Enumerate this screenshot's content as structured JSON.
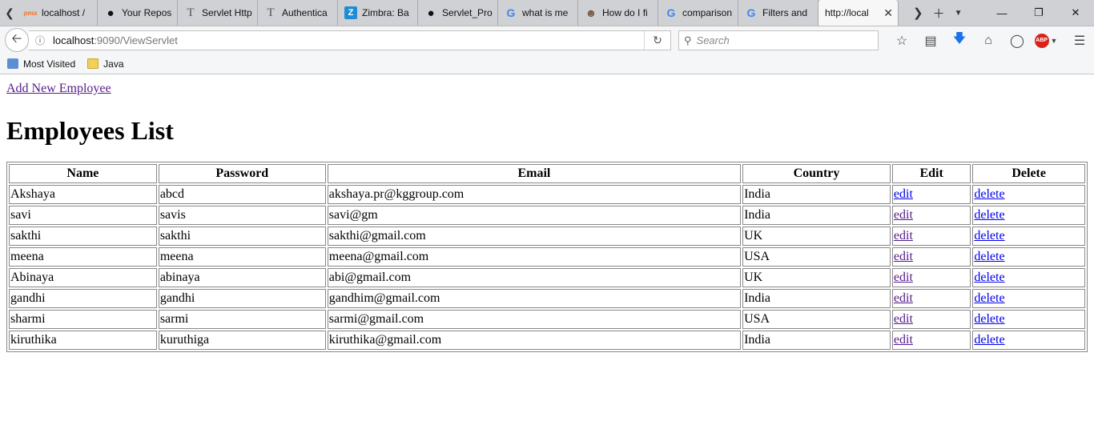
{
  "browser": {
    "tabs": [
      {
        "title": "localhost /",
        "icon": "phpmyadmin-icon"
      },
      {
        "title": "Your Repos",
        "icon": "github-icon"
      },
      {
        "title": "Servlet Http",
        "icon": "tutorial-t-icon"
      },
      {
        "title": "Authentica",
        "icon": "tutorial-t-icon"
      },
      {
        "title": "Zimbra: Ba",
        "icon": "zimbra-icon"
      },
      {
        "title": "Servlet_Pro",
        "icon": "github-icon"
      },
      {
        "title": "what is me",
        "icon": "google-icon"
      },
      {
        "title": "How do I fi",
        "icon": "stackoverflow-avatar-icon"
      },
      {
        "title": "comparison",
        "icon": "google-icon"
      },
      {
        "title": "Filters and",
        "icon": "google-icon"
      },
      {
        "title": "http://local",
        "icon": "none",
        "active": true
      }
    ],
    "url_host": "localhost",
    "url_path": ":9090/ViewServlet",
    "search_placeholder": "Search",
    "abp_label": "ABP",
    "bookmarks": [
      {
        "label": "Most Visited",
        "icon": "most-visited-icon"
      },
      {
        "label": "Java",
        "icon": "folder-icon"
      }
    ]
  },
  "page": {
    "add_link": "Add New Employee",
    "heading": "Employees List",
    "columns": [
      "Name",
      "Password",
      "Email",
      "Country",
      "Edit",
      "Delete"
    ],
    "rows": [
      {
        "name": "Akshaya",
        "password": "abcd",
        "email": "akshaya.pr@kggroup.com",
        "country": "India",
        "edit": "edit",
        "delete": "delete",
        "edit_visited": false
      },
      {
        "name": "savi",
        "password": "savis",
        "email": "savi@gm",
        "country": "India",
        "edit": "edit",
        "delete": "delete",
        "edit_visited": true
      },
      {
        "name": "sakthi",
        "password": "sakthi",
        "email": "sakthi@gmail.com",
        "country": "UK",
        "edit": "edit",
        "delete": "delete",
        "edit_visited": true
      },
      {
        "name": "meena",
        "password": "meena",
        "email": "meena@gmail.com",
        "country": "USA",
        "edit": "edit",
        "delete": "delete",
        "edit_visited": true
      },
      {
        "name": "Abinaya",
        "password": "abinaya",
        "email": "abi@gmail.com",
        "country": "UK",
        "edit": "edit",
        "delete": "delete",
        "edit_visited": true
      },
      {
        "name": "gandhi",
        "password": "gandhi",
        "email": "gandhim@gmail.com",
        "country": "India",
        "edit": "edit",
        "delete": "delete",
        "edit_visited": true
      },
      {
        "name": "sharmi",
        "password": "sarmi",
        "email": "sarmi@gmail.com",
        "country": "USA",
        "edit": "edit",
        "delete": "delete",
        "edit_visited": true
      },
      {
        "name": "kiruthika",
        "password": "kuruthiga",
        "email": "kiruthika@gmail.com",
        "country": "India",
        "edit": "edit",
        "delete": "delete",
        "edit_visited": true
      }
    ]
  },
  "colors": {
    "link": "#0000ee",
    "visited_link": "#551a8b",
    "tabbar_bg": "#cfd1d4",
    "toolbar_bg": "#f5f6f7"
  }
}
